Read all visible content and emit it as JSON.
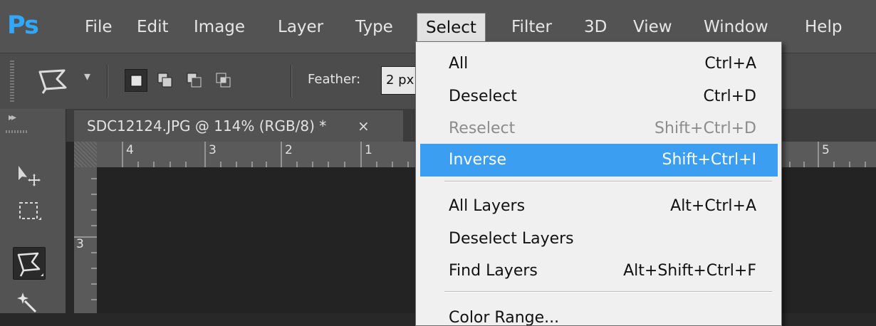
{
  "app": {
    "logo": "Ps"
  },
  "menubar": [
    {
      "label": "File"
    },
    {
      "label": "Edit"
    },
    {
      "label": "Image"
    },
    {
      "label": "Layer"
    },
    {
      "label": "Type"
    },
    {
      "label": "Select",
      "active": true
    },
    {
      "label": "Filter"
    },
    {
      "label": "3D"
    },
    {
      "label": "View"
    },
    {
      "label": "Window"
    },
    {
      "label": "Help"
    }
  ],
  "options": {
    "feather_label": "Feather:",
    "feather_value": "2 px"
  },
  "document": {
    "tab_title": "SDC12124.JPG @ 114% (RGB/8) *",
    "close_glyph": "×"
  },
  "rulers": {
    "top": [
      "4",
      "3",
      "2",
      "1",
      "5"
    ],
    "left": [
      "3"
    ]
  },
  "select_menu": {
    "items": [
      {
        "label": "All",
        "shortcut": "Ctrl+A",
        "state": "normal"
      },
      {
        "label": "Deselect",
        "shortcut": "Ctrl+D",
        "state": "normal"
      },
      {
        "label": "Reselect",
        "shortcut": "Shift+Ctrl+D",
        "state": "disabled"
      },
      {
        "label": "Inverse",
        "shortcut": "Shift+Ctrl+I",
        "state": "highlighted"
      },
      {
        "label": "All Layers",
        "shortcut": "Alt+Ctrl+A",
        "state": "normal"
      },
      {
        "label": "Deselect Layers",
        "shortcut": "",
        "state": "normal"
      },
      {
        "label": "Find Layers",
        "shortcut": "Alt+Shift+Ctrl+F",
        "state": "normal"
      },
      {
        "label": "Color Range...",
        "shortcut": "",
        "state": "normal"
      }
    ]
  },
  "colors": {
    "accent": "#30a8ff",
    "highlight": "#3c9ef0",
    "menubar": "#535353",
    "canvas": "#232323"
  }
}
